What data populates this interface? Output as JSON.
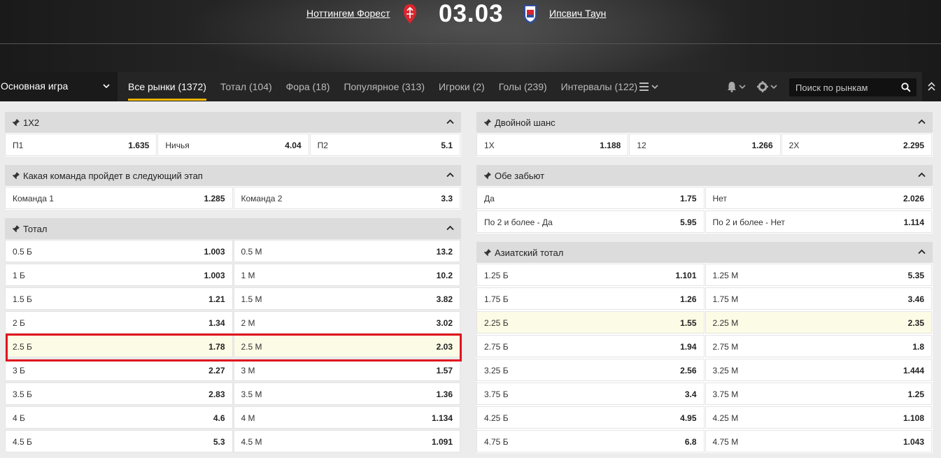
{
  "header": {
    "home_team": "Ноттингем Форест",
    "away_team": "Ипсвич Таун",
    "score": "03.03",
    "home_crest_color": "#d9262f",
    "away_crest_color": "#2d4fa0"
  },
  "nav": {
    "game_select": "Основная игра",
    "tabs": [
      {
        "label": "Все рынки",
        "count": "(1372)"
      },
      {
        "label": "Тотал",
        "count": "(104)"
      },
      {
        "label": "Фора",
        "count": "(18)"
      },
      {
        "label": "Популярное",
        "count": "(313)"
      },
      {
        "label": "Игроки",
        "count": "(2)"
      },
      {
        "label": "Голы",
        "count": "(239)"
      },
      {
        "label": "Интервалы",
        "count": "(122)"
      }
    ],
    "search_placeholder": "Поиск по рынкам",
    "accent": "#f0b400"
  },
  "markets": {
    "m1x2": {
      "title": "1X2",
      "cells": [
        {
          "label": "П1",
          "odd": "1.635"
        },
        {
          "label": "Ничья",
          "odd": "4.04"
        },
        {
          "label": "П2",
          "odd": "5.1"
        }
      ]
    },
    "next_stage": {
      "title": "Какая команда пройдет в следующий этап",
      "cells": [
        {
          "label": "Команда 1",
          "odd": "1.285"
        },
        {
          "label": "Команда 2",
          "odd": "3.3"
        }
      ]
    },
    "total": {
      "title": "Тотал",
      "rows": [
        [
          {
            "label": "0.5 Б",
            "odd": "1.003"
          },
          {
            "label": "0.5 М",
            "odd": "13.2"
          }
        ],
        [
          {
            "label": "1 Б",
            "odd": "1.003"
          },
          {
            "label": "1 М",
            "odd": "10.2"
          }
        ],
        [
          {
            "label": "1.5 Б",
            "odd": "1.21"
          },
          {
            "label": "1.5 М",
            "odd": "3.82"
          }
        ],
        [
          {
            "label": "2 Б",
            "odd": "1.34"
          },
          {
            "label": "2 М",
            "odd": "3.02"
          }
        ],
        [
          {
            "label": "2.5 Б",
            "odd": "1.78"
          },
          {
            "label": "2.5 М",
            "odd": "2.03"
          }
        ],
        [
          {
            "label": "3 Б",
            "odd": "2.27"
          },
          {
            "label": "3 М",
            "odd": "1.57"
          }
        ],
        [
          {
            "label": "3.5 Б",
            "odd": "2.83"
          },
          {
            "label": "3.5 М",
            "odd": "1.36"
          }
        ],
        [
          {
            "label": "4 Б",
            "odd": "4.6"
          },
          {
            "label": "4 М",
            "odd": "1.134"
          }
        ],
        [
          {
            "label": "4.5 Б",
            "odd": "5.3"
          },
          {
            "label": "4.5 М",
            "odd": "1.091"
          }
        ]
      ]
    },
    "double_chance": {
      "title": "Двойной шанс",
      "cells": [
        {
          "label": "1X",
          "odd": "1.188"
        },
        {
          "label": "12",
          "odd": "1.266"
        },
        {
          "label": "2X",
          "odd": "2.295"
        }
      ]
    },
    "both_score": {
      "title": "Обе забьют",
      "rows": [
        [
          {
            "label": "Да",
            "odd": "1.75"
          },
          {
            "label": "Нет",
            "odd": "2.026"
          }
        ],
        [
          {
            "label": "По 2 и более - Да",
            "odd": "5.95"
          },
          {
            "label": "По 2 и более - Нет",
            "odd": "1.114"
          }
        ]
      ]
    },
    "asian_total": {
      "title": "Азиатский тотал",
      "rows": [
        [
          {
            "label": "1.25 Б",
            "odd": "1.101"
          },
          {
            "label": "1.25 М",
            "odd": "5.35"
          }
        ],
        [
          {
            "label": "1.75 Б",
            "odd": "1.26"
          },
          {
            "label": "1.75 М",
            "odd": "3.46"
          }
        ],
        [
          {
            "label": "2.25 Б",
            "odd": "1.55"
          },
          {
            "label": "2.25 М",
            "odd": "2.35"
          }
        ],
        [
          {
            "label": "2.75 Б",
            "odd": "1.94"
          },
          {
            "label": "2.75 М",
            "odd": "1.8"
          }
        ],
        [
          {
            "label": "3.25 Б",
            "odd": "2.56"
          },
          {
            "label": "3.25 М",
            "odd": "1.444"
          }
        ],
        [
          {
            "label": "3.75 Б",
            "odd": "3.4"
          },
          {
            "label": "3.75 М",
            "odd": "1.25"
          }
        ],
        [
          {
            "label": "4.25 Б",
            "odd": "4.95"
          },
          {
            "label": "4.25 М",
            "odd": "1.108"
          }
        ],
        [
          {
            "label": "4.75 Б",
            "odd": "6.8"
          },
          {
            "label": "4.75 М",
            "odd": "1.043"
          }
        ]
      ]
    }
  }
}
